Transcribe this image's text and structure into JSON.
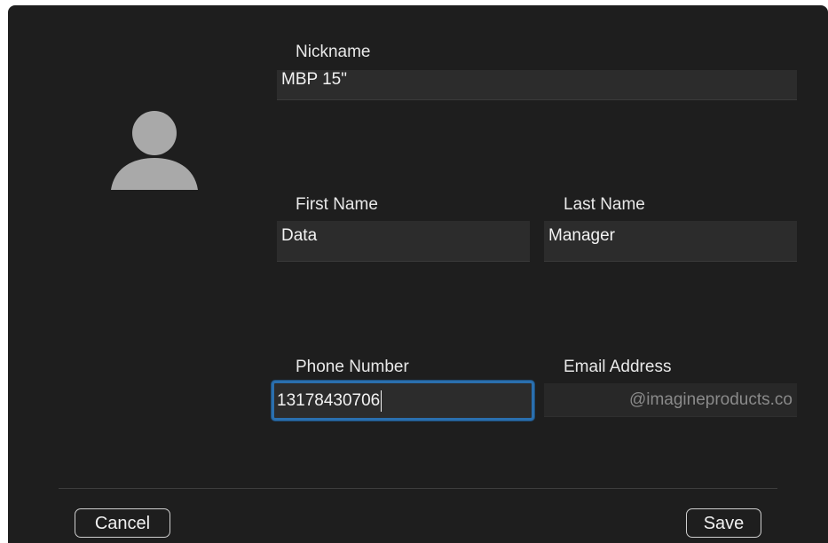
{
  "avatar": {
    "icon": "person-icon",
    "color": "#a9a9a9"
  },
  "nickname": {
    "label": "Nickname",
    "value": "MBP 15\""
  },
  "first_name": {
    "label": "First Name",
    "value": "Data"
  },
  "last_name": {
    "label": "Last Name",
    "value": "Manager"
  },
  "phone": {
    "label": "Phone Number",
    "value": "13178430706"
  },
  "email": {
    "label": "Email Address",
    "value": "@imagineproducts.co"
  },
  "buttons": {
    "cancel": "Cancel",
    "save": "Save"
  },
  "colors": {
    "background": "#1e1e1e",
    "field": "#2c2c2c",
    "focus_ring": "#2a6fae",
    "text": "#f2f2f2",
    "muted_text": "#8a8a8a"
  }
}
